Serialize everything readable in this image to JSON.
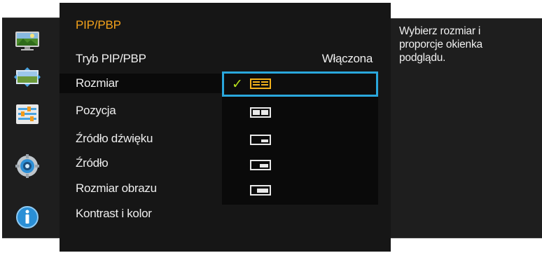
{
  "menu": {
    "title": "PIP/PBP",
    "items": [
      {
        "label": "Tryb PIP/PBP",
        "value": "Włączona"
      },
      {
        "label": "Rozmiar"
      },
      {
        "label": "Pozycja"
      },
      {
        "label": "Źródło dźwięku"
      },
      {
        "label": "Źródło"
      },
      {
        "label": "Rozmiar obrazu"
      },
      {
        "label": "Kontrast i kolor"
      }
    ]
  },
  "submenu": {
    "options": [
      {
        "name": "split-equal",
        "selected": true
      },
      {
        "name": "split-equal-alt",
        "selected": false
      },
      {
        "name": "pip-small",
        "selected": false
      },
      {
        "name": "pip-medium",
        "selected": false
      },
      {
        "name": "pip-large",
        "selected": false
      }
    ],
    "check_glyph": "✓"
  },
  "help": {
    "text": "Wybierz rozmiar i proporcje okienka podglądu."
  },
  "sidebar": {
    "icons": [
      "picture-icon",
      "screen-size-icon",
      "pip-settings-icon",
      "settings-gear-icon",
      "info-icon"
    ]
  },
  "colors": {
    "title": "#f3a21b",
    "selection_outline": "#2aa7dc",
    "check": "#b7e01c"
  }
}
